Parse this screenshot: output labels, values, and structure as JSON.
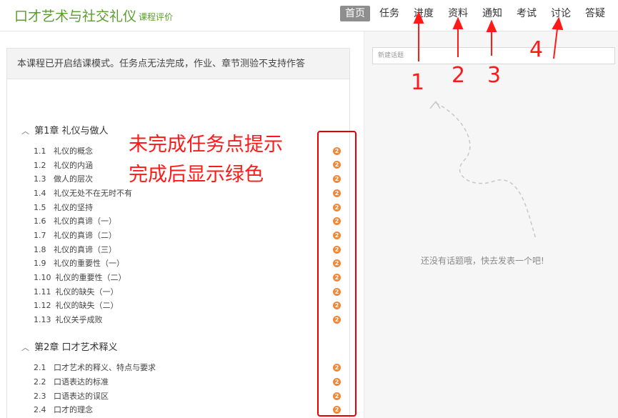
{
  "header": {
    "title": "口才艺术与社交礼仪",
    "eval_link": "课程评价",
    "nav": [
      {
        "label": "首页",
        "active": true
      },
      {
        "label": "任务",
        "active": false
      },
      {
        "label": "进度",
        "active": false
      },
      {
        "label": "资料",
        "active": false
      },
      {
        "label": "通知",
        "active": false
      },
      {
        "label": "考试",
        "active": false
      },
      {
        "label": "讨论",
        "active": false
      },
      {
        "label": "答疑",
        "active": false
      }
    ]
  },
  "notice": "本课程已开启结课模式。任务点无法完成，作业、章节测验不支持作答",
  "chapters": [
    {
      "title": "第1章 礼仪与做人",
      "lessons": [
        {
          "num": "1.1",
          "title": "礼仪的概念",
          "badge": "2"
        },
        {
          "num": "1.2",
          "title": "礼仪的内涵",
          "badge": "2"
        },
        {
          "num": "1.3",
          "title": "做人的层次",
          "badge": "2"
        },
        {
          "num": "1.4",
          "title": "礼仪无处不在无时不有",
          "badge": "2"
        },
        {
          "num": "1.5",
          "title": "礼仪的坚持",
          "badge": "2"
        },
        {
          "num": "1.6",
          "title": "礼仪的真谛（一）",
          "badge": "2"
        },
        {
          "num": "1.7",
          "title": "礼仪的真谛（二）",
          "badge": "2"
        },
        {
          "num": "1.8",
          "title": "礼仪的真谛（三）",
          "badge": "2"
        },
        {
          "num": "1.9",
          "title": "礼仪的重要性（一）",
          "badge": "2"
        },
        {
          "num": "1.10",
          "title": "礼仪的重要性（二）",
          "badge": "2"
        },
        {
          "num": "1.11",
          "title": "礼仪的缺失（一）",
          "badge": "2"
        },
        {
          "num": "1.12",
          "title": "礼仪的缺失（二）",
          "badge": "2"
        },
        {
          "num": "1.13",
          "title": "礼仪关乎成败",
          "badge": "2"
        }
      ]
    },
    {
      "title": "第2章 口才艺术释义",
      "lessons": [
        {
          "num": "2.1",
          "title": "口才艺术的释义、特点与要求",
          "badge": "2"
        },
        {
          "num": "2.2",
          "title": "口语表达的标准",
          "badge": "2"
        },
        {
          "num": "2.3",
          "title": "口语表达的误区",
          "badge": "2"
        },
        {
          "num": "2.4",
          "title": "口才的理念",
          "badge": "2"
        }
      ]
    }
  ],
  "discussion": {
    "input_placeholder": "新建话题",
    "empty_text": "还没有话题哦，快去发表一个吧!"
  },
  "annotations": {
    "note_line1": "未完成任务点提示",
    "note_line2": "完成后显示绿色",
    "numbers": [
      "1",
      "2",
      "3",
      "4"
    ],
    "color": "#ff1a1a"
  },
  "colors": {
    "brand_green": "#5a9e2c",
    "badge_orange": "#f0883a",
    "active_nav": "#8e8e8e"
  }
}
